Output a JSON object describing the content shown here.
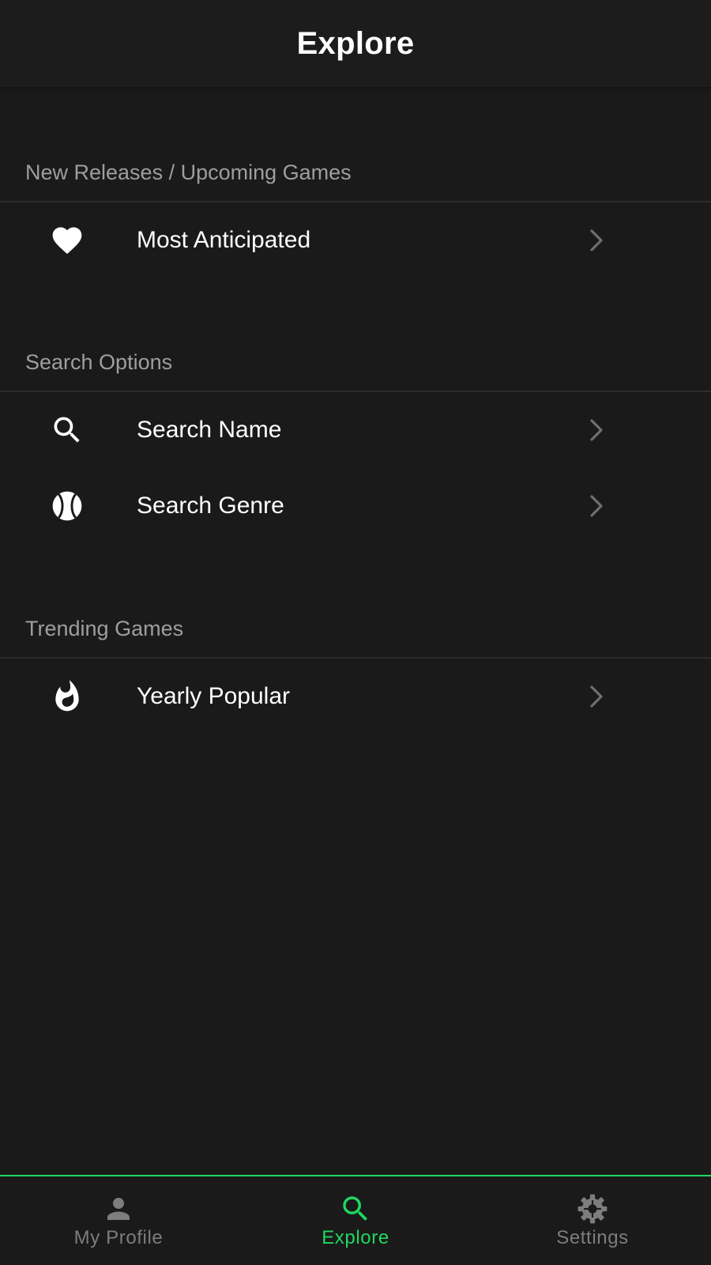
{
  "header": {
    "title": "Explore"
  },
  "sections": [
    {
      "title": "New Releases / Upcoming Games",
      "items": [
        {
          "label": "Most Anticipated",
          "icon": "heart-icon"
        }
      ]
    },
    {
      "title": "Search Options",
      "items": [
        {
          "label": "Search Name",
          "icon": "search-icon"
        },
        {
          "label": "Search Genre",
          "icon": "ball-icon"
        }
      ]
    },
    {
      "title": "Trending Games",
      "items": [
        {
          "label": "Yearly Popular",
          "icon": "flame-icon"
        }
      ]
    }
  ],
  "bottom_nav": {
    "items": [
      {
        "label": "My Profile",
        "icon": "person-icon",
        "active": false
      },
      {
        "label": "Explore",
        "icon": "search-icon",
        "active": true
      },
      {
        "label": "Settings",
        "icon": "gear-icon",
        "active": false
      }
    ]
  },
  "colors": {
    "background": "#1a1a1a",
    "accent": "#1fd760",
    "section_title": "#9e9e9e",
    "inactive_nav": "#7d7d7d",
    "chevron": "#6f6f6f"
  }
}
